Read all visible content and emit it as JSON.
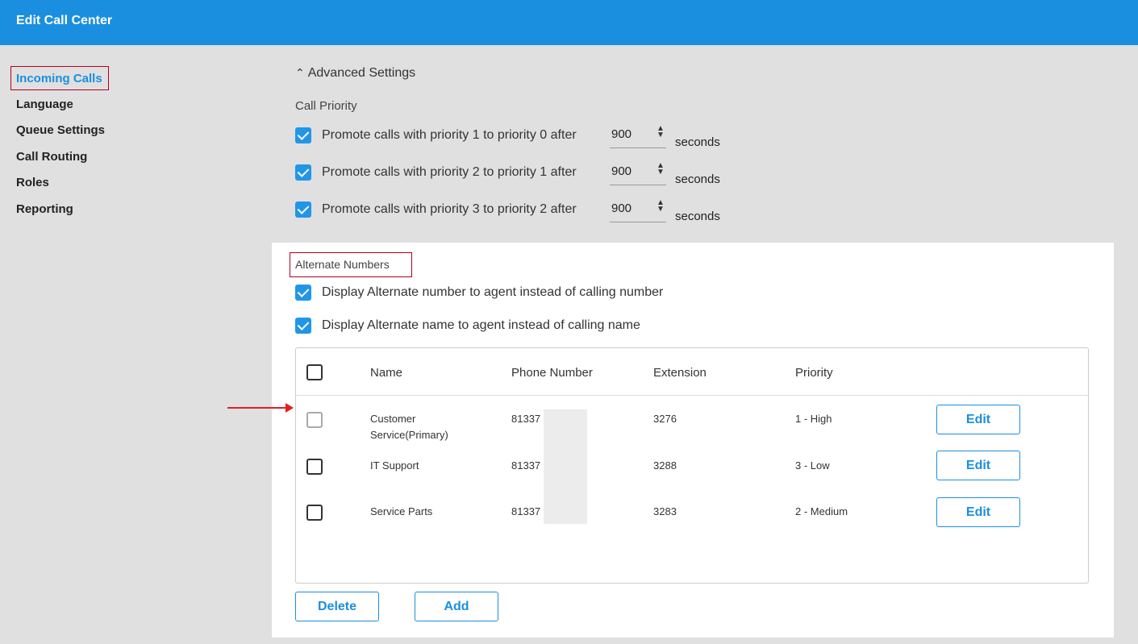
{
  "header": {
    "title": "Edit Call Center"
  },
  "sidebar": {
    "items": [
      {
        "label": "Incoming Calls"
      },
      {
        "label": "Language"
      },
      {
        "label": "Queue Settings"
      },
      {
        "label": "Call Routing"
      },
      {
        "label": "Roles"
      },
      {
        "label": "Reporting"
      }
    ]
  },
  "advanced": {
    "toggle_label": "Advanced Settings",
    "call_priority_label": "Call Priority",
    "rules": [
      {
        "text": "Promote calls with priority 1 to priority 0 after",
        "value": "900",
        "unit": "seconds",
        "checked": true
      },
      {
        "text": "Promote calls with priority 2 to priority 1 after",
        "value": "900",
        "unit": "seconds",
        "checked": true
      },
      {
        "text": "Promote calls with priority 3 to priority 2 after",
        "value": "900",
        "unit": "seconds",
        "checked": true
      }
    ]
  },
  "alternate": {
    "title": "Alternate Numbers",
    "option1": "Display Alternate number to agent instead of calling number",
    "option2": "Display Alternate name to agent instead of calling name",
    "columns": [
      "Name",
      "Phone Number",
      "Extension",
      "Priority"
    ],
    "rows": [
      {
        "name_line1": "Customer",
        "name_line2": "Service(Primary)",
        "phone": "81337",
        "extension": "3276",
        "priority": "1 - High",
        "edit": "Edit"
      },
      {
        "name_line1": "IT Support",
        "name_line2": "",
        "phone": "81337",
        "extension": "3288",
        "priority": "3 - Low",
        "edit": "Edit"
      },
      {
        "name_line1": "Service Parts",
        "name_line2": "",
        "phone": "81337",
        "extension": "3283",
        "priority": "2 - Medium",
        "edit": "Edit"
      }
    ],
    "delete_label": "Delete",
    "add_label": "Add"
  },
  "colors": {
    "accent": "#1a8fdf",
    "checkbox": "#2196e8",
    "highlight": "#b00020",
    "arrow": "#e02020"
  }
}
